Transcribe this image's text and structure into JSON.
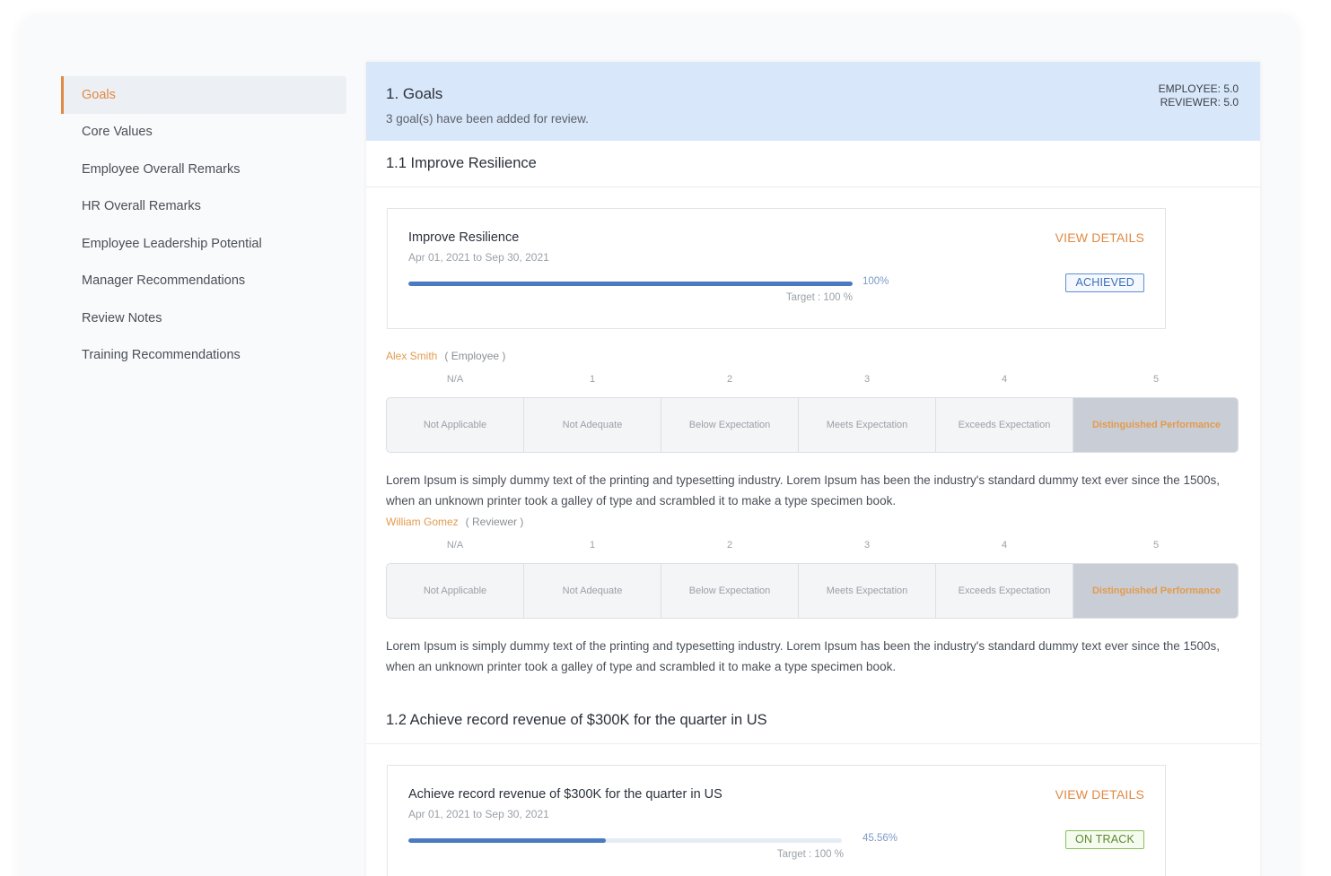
{
  "sidebar": {
    "items": [
      {
        "label": "Goals",
        "active": true
      },
      {
        "label": "Core Values"
      },
      {
        "label": "Employee Overall Remarks"
      },
      {
        "label": "HR Overall Remarks"
      },
      {
        "label": "Employee Leadership Potential"
      },
      {
        "label": "Manager Recommendations"
      },
      {
        "label": "Review Notes"
      },
      {
        "label": "Training Recommendations"
      }
    ]
  },
  "header": {
    "title": "1. Goals",
    "subtitle": "3 goal(s) have been added for review.",
    "employee_score": "EMPLOYEE: 5.0",
    "reviewer_score": "REVIEWER: 5.0"
  },
  "rating_scale": {
    "numbers": [
      "N/A",
      "1",
      "2",
      "3",
      "4",
      "5"
    ],
    "labels": [
      "Not Applicable",
      "Not Adequate",
      "Below Expectation",
      "Meets Expectation",
      "Exceeds Expectation",
      "Distinguished Performance"
    ]
  },
  "goals": [
    {
      "section_title": "1.1 Improve Resilience",
      "name": "Improve Resilience",
      "dates": "Apr 01, 2021 to Sep 30, 2021",
      "progress": 100,
      "progress_text": "100%",
      "target_text": "Target : 100 %",
      "view_details": "VIEW DETAILS",
      "status": "ACHIEVED",
      "employee": {
        "name": "Alex Smith",
        "role": "( Employee )",
        "rating": 5,
        "comment": "Lorem Ipsum is simply dummy text of the printing and typesetting industry. Lorem Ipsum has been the industry's standard dummy text ever since the 1500s, when an unknown printer took a galley of type and scrambled it to make a type specimen book."
      },
      "reviewer": {
        "name": "William Gomez",
        "role": "( Reviewer )",
        "rating": 5,
        "comment": "Lorem Ipsum is simply dummy text of the printing and typesetting industry. Lorem Ipsum has been the industry's standard dummy text ever since the 1500s, when an unknown printer took a galley of type and scrambled it to make a type specimen book."
      }
    },
    {
      "section_title": "1.2 Achieve record revenue of $300K for the quarter in US",
      "name": "Achieve record revenue of $300K for the quarter in US",
      "dates": "Apr 01, 2021 to Sep 30, 2021",
      "progress": 45.56,
      "progress_text": "45.56%",
      "target_text": "Target : 100 %",
      "view_details": "VIEW DETAILS",
      "status": "ON TRACK"
    }
  ]
}
